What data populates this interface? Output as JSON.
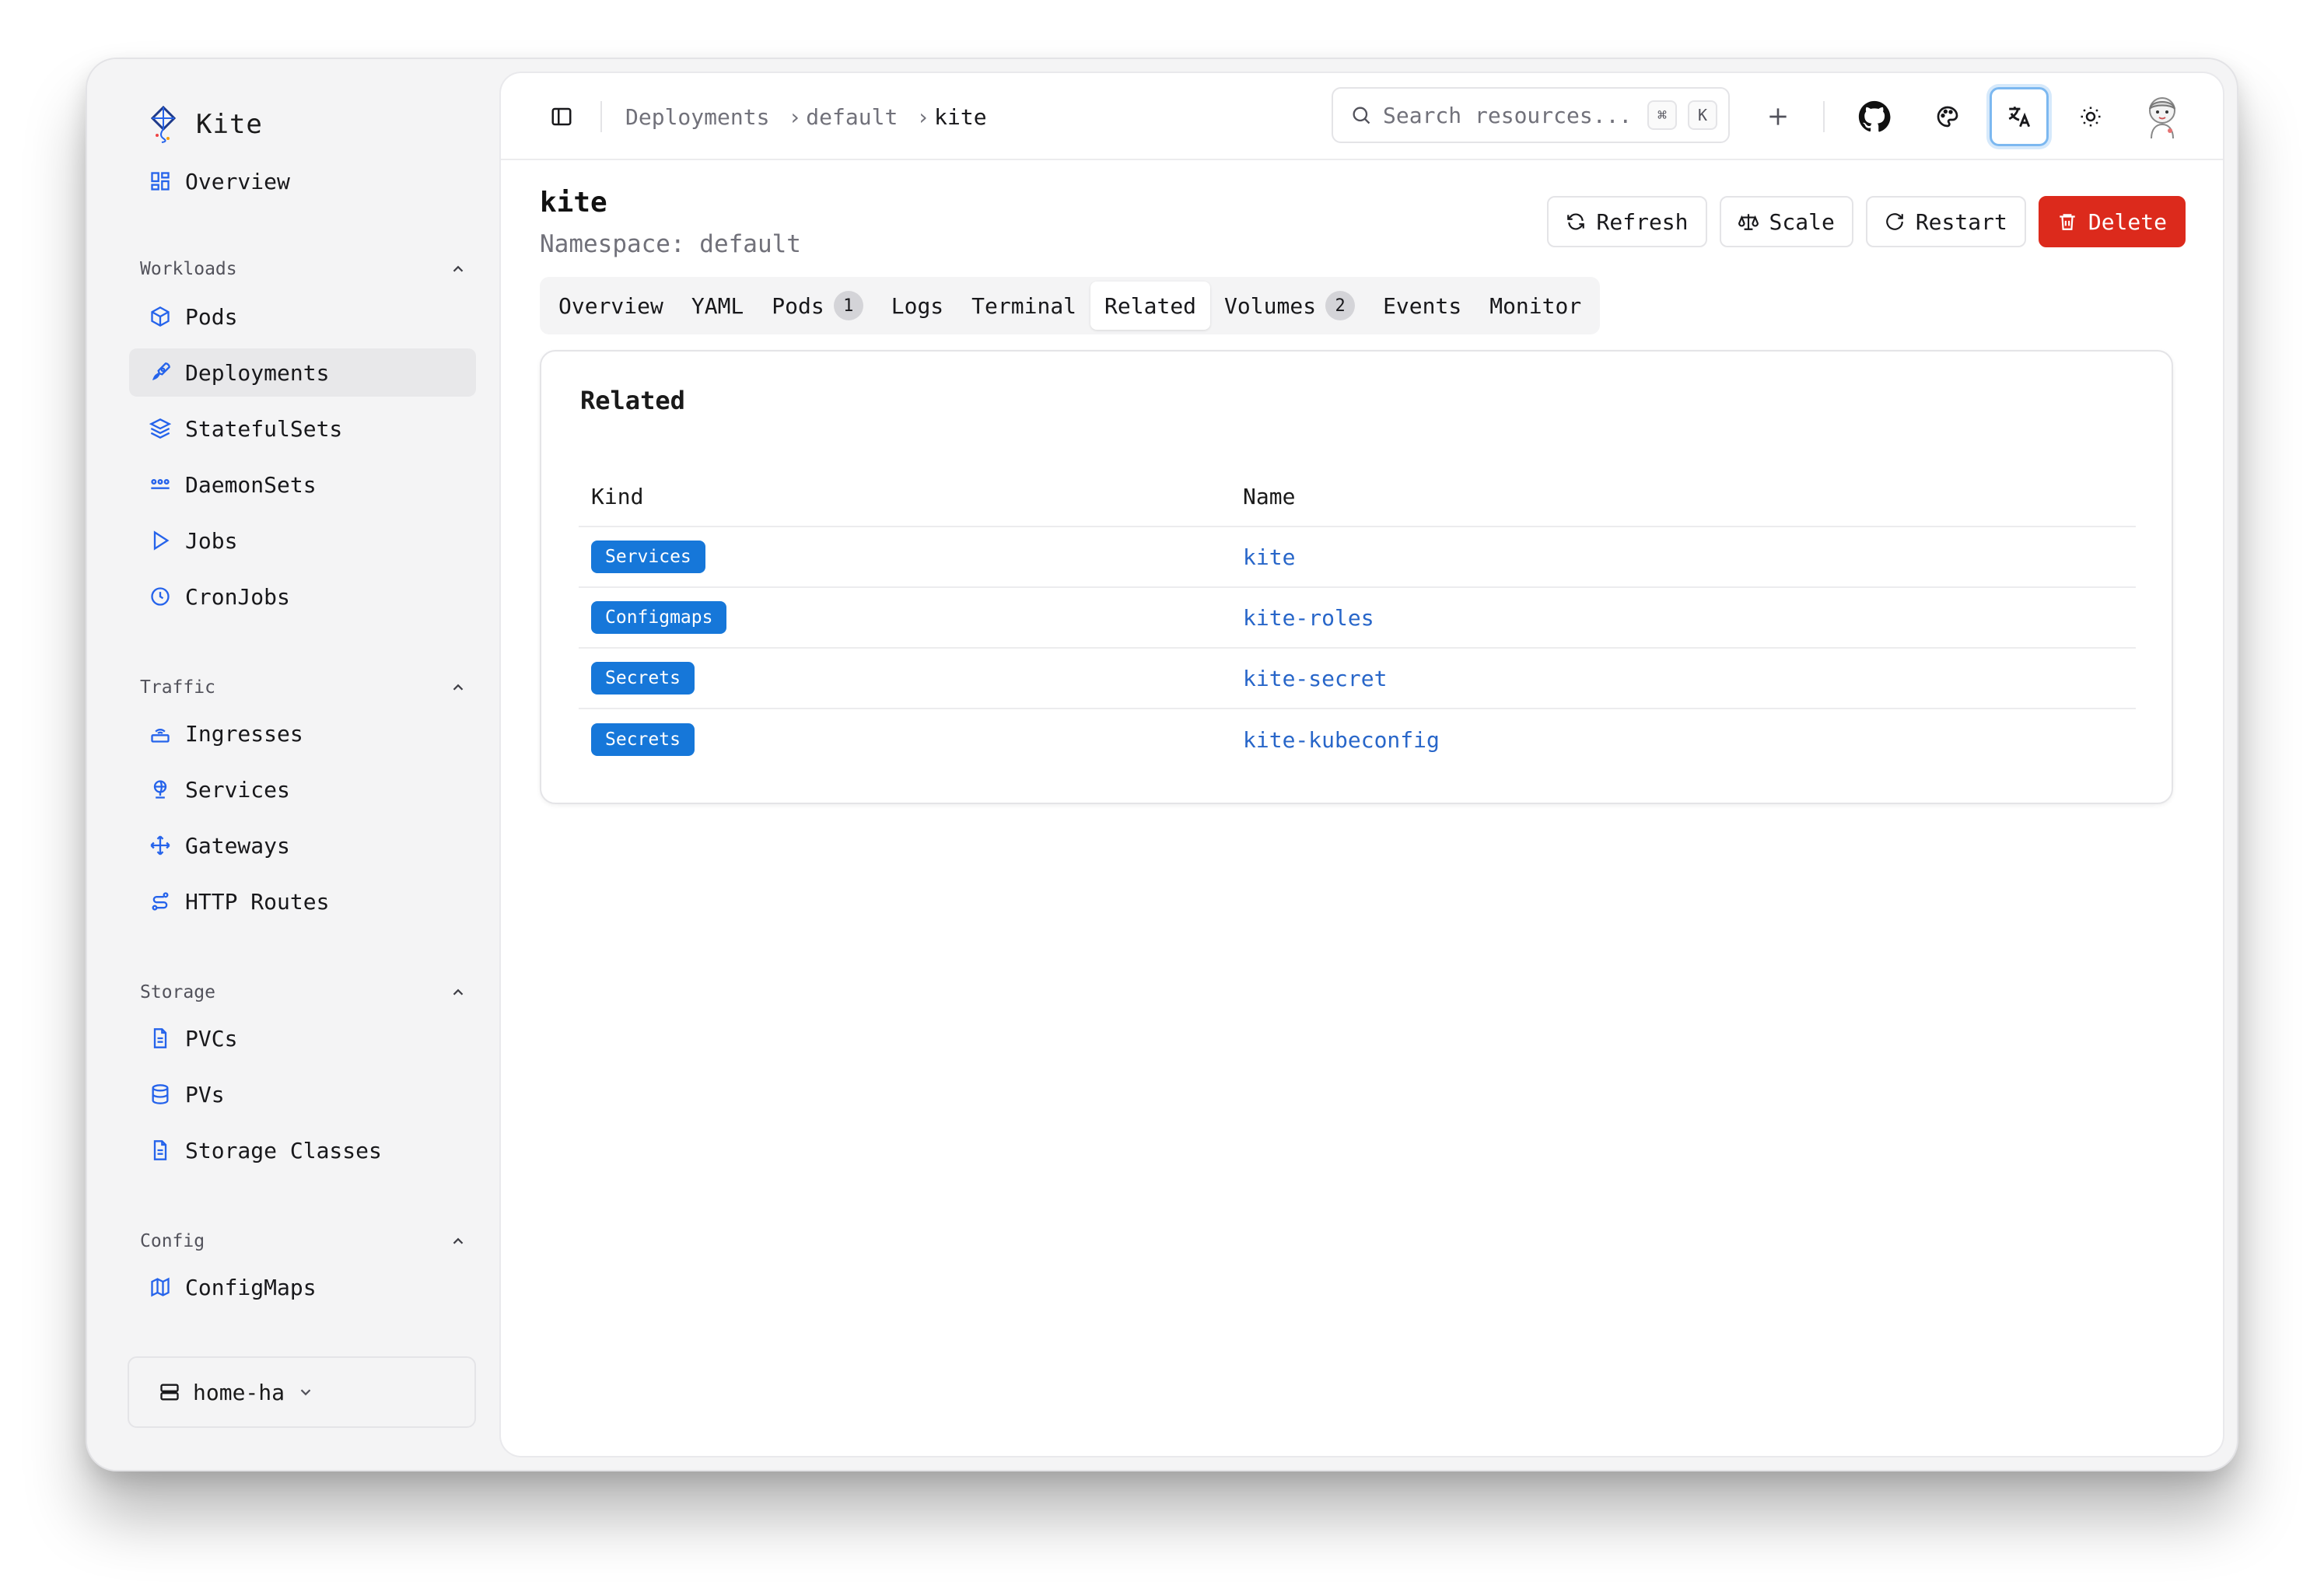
{
  "app": {
    "name": "Kite"
  },
  "sidebar": {
    "overview": "Overview",
    "groups": [
      {
        "title": "Workloads",
        "items": [
          "Pods",
          "Deployments",
          "StatefulSets",
          "DaemonSets",
          "Jobs",
          "CronJobs"
        ]
      },
      {
        "title": "Traffic",
        "items": [
          "Ingresses",
          "Services",
          "Gateways",
          "HTTP Routes"
        ]
      },
      {
        "title": "Storage",
        "items": [
          "PVCs",
          "PVs",
          "Storage Classes"
        ]
      },
      {
        "title": "Config",
        "items": [
          "ConfigMaps"
        ]
      }
    ],
    "active_item": "Deployments",
    "cluster": "home-ha"
  },
  "topbar": {
    "breadcrumbs": [
      "Deployments",
      "default",
      "kite"
    ],
    "search_placeholder": "Search resources...",
    "shortcut_keys": [
      "⌘",
      "K"
    ]
  },
  "page": {
    "title": "kite",
    "subtitle": "Namespace: default",
    "actions": {
      "refresh": "Refresh",
      "scale": "Scale",
      "restart": "Restart",
      "delete": "Delete"
    },
    "tabs": [
      {
        "label": "Overview"
      },
      {
        "label": "YAML"
      },
      {
        "label": "Pods",
        "count": "1"
      },
      {
        "label": "Logs"
      },
      {
        "label": "Terminal"
      },
      {
        "label": "Related"
      },
      {
        "label": "Volumes",
        "count": "2"
      },
      {
        "label": "Events"
      },
      {
        "label": "Monitor"
      }
    ],
    "active_tab": "Related"
  },
  "related": {
    "title": "Related",
    "columns": [
      "Kind",
      "Name"
    ],
    "rows": [
      {
        "kind": "Services",
        "name": "kite"
      },
      {
        "kind": "Configmaps",
        "name": "kite-roles"
      },
      {
        "kind": "Secrets",
        "name": "kite-secret"
      },
      {
        "kind": "Secrets",
        "name": "kite-kubeconfig"
      }
    ]
  },
  "colors": {
    "accent": "#1677d9",
    "link": "#2866c9",
    "danger": "#dc2a1c",
    "icon_blue": "#2563eb"
  }
}
